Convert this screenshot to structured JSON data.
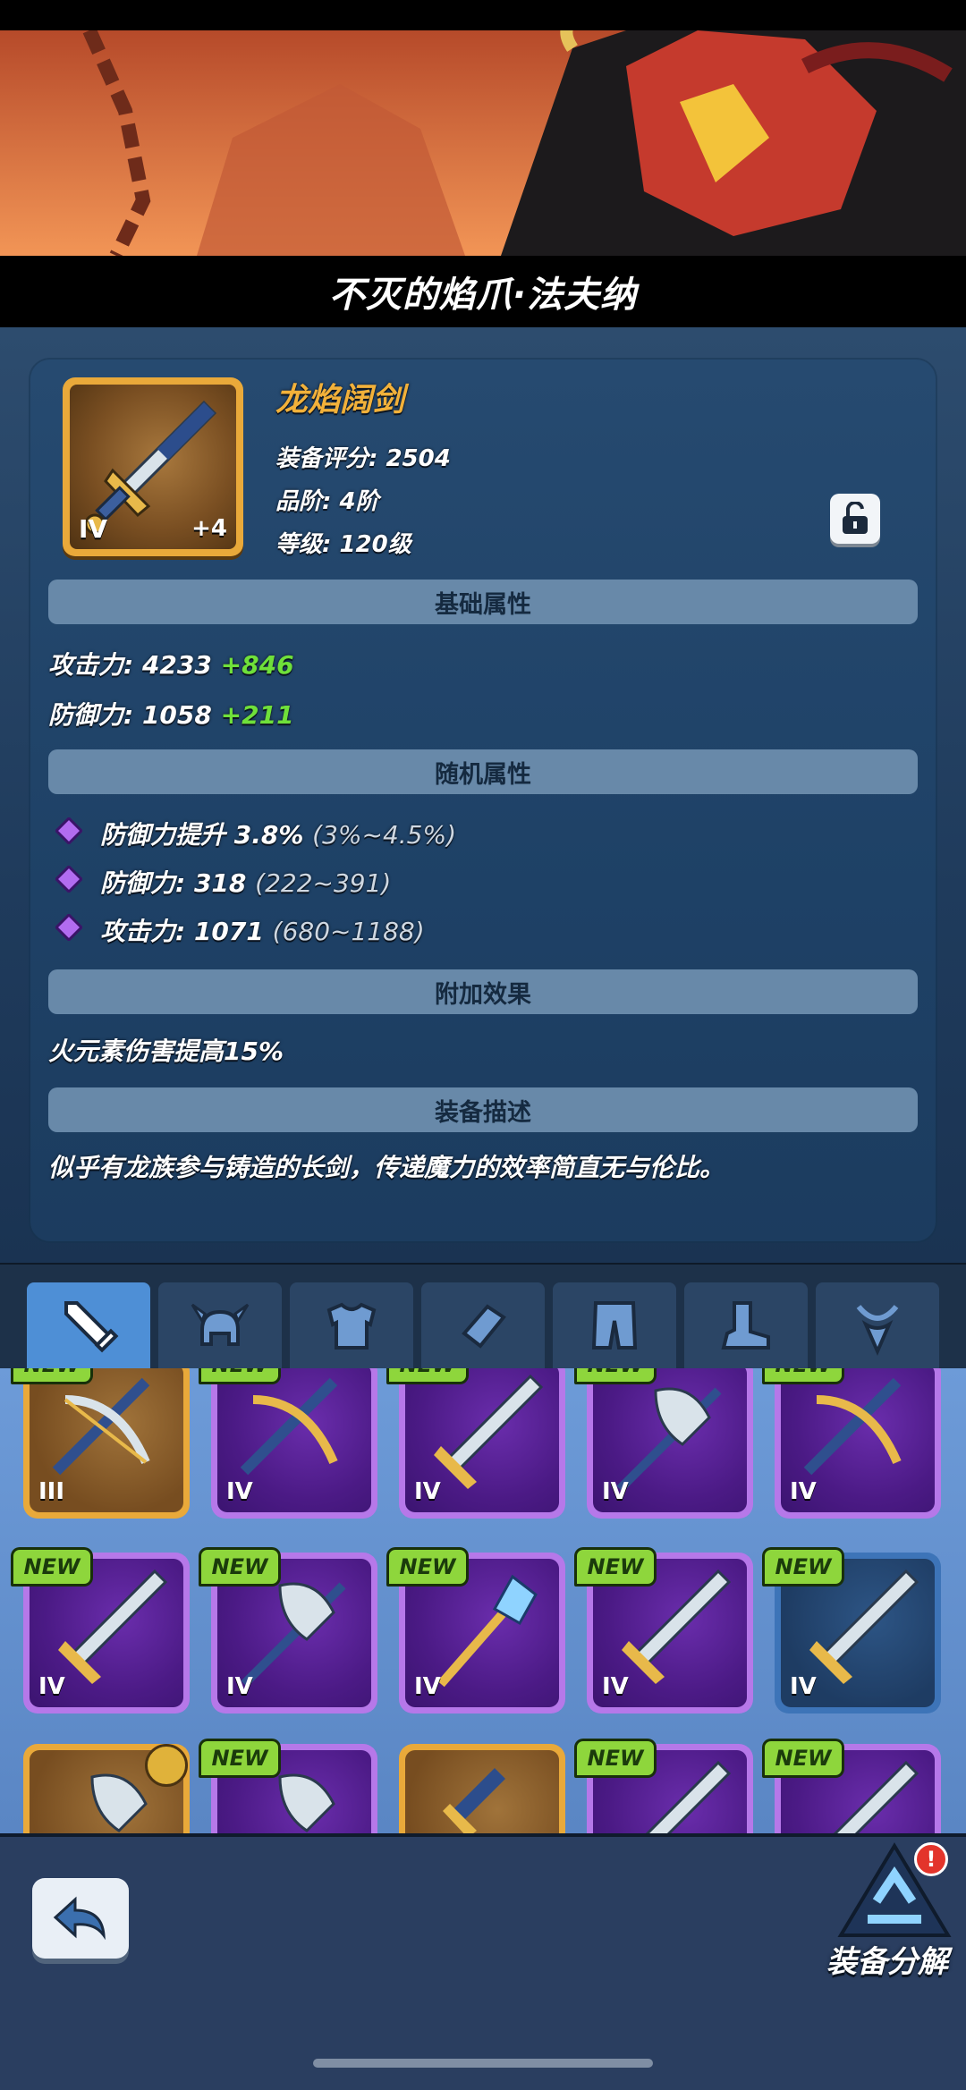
{
  "hero": {
    "title": "不灭的焰爪·法夫纳"
  },
  "item": {
    "name": "龙焰阔剑",
    "tier": "IV",
    "enhance": "+4",
    "score_label": "装备评分: 2504",
    "grade_label": "品阶: 4阶",
    "level_label": "等级: 120级"
  },
  "sections": {
    "base": "基础属性",
    "random": "随机属性",
    "extra": "附加效果",
    "desc": "装备描述"
  },
  "base_stats": [
    {
      "label": "攻击力: 4233",
      "bonus": "+846"
    },
    {
      "label": "防御力: 1058",
      "bonus": "+211"
    }
  ],
  "random_stats": [
    {
      "label": "防御力提升 3.8%",
      "range": "(3%~4.5%)"
    },
    {
      "label": "防御力: 318",
      "range": "(222~391)"
    },
    {
      "label": "攻击力: 1071",
      "range": "(680~1188)"
    }
  ],
  "extra_effect": "火元素伤害提高15%",
  "description": "似乎有龙族参与铸造的长剑，传递魔力的效率简直无与伦比。",
  "tabs": [
    "weapon-tab",
    "helmet-tab",
    "armor-tab",
    "bracer-tab",
    "pants-tab",
    "boots-tab",
    "necklace-tab"
  ],
  "inventory": {
    "new_label": "NEW",
    "row1": [
      "III",
      "IV",
      "IV",
      "IV",
      "IV"
    ],
    "row2": [
      "IV",
      "IV",
      "IV",
      "IV",
      "IV"
    ]
  },
  "bottom": {
    "salvage_label": "装备分解",
    "alert": "!"
  },
  "colors": {
    "gold": "#f2b13a",
    "bonus_green": "#6fe03a",
    "purple_frame": "#b678e9",
    "gold_frame": "#e9a93a"
  }
}
